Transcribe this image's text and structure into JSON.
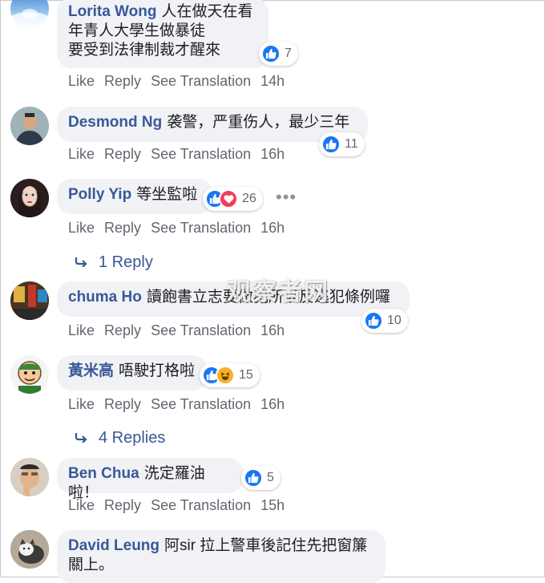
{
  "comments": [
    {
      "author": "Lorita Wong",
      "text": "人在做天在看\n年青人大學生做暴徒\n要受到法律制裁才醒來",
      "reactions": {
        "count": "7",
        "types": [
          "like"
        ]
      },
      "actions": {
        "like": "Like",
        "reply": "Reply",
        "translate": "See Translation",
        "time": "14h"
      }
    },
    {
      "author": "Desmond Ng",
      "text": "袭警，严重伤人，最少三年",
      "reactions": {
        "count": "11",
        "types": [
          "like"
        ]
      },
      "actions": {
        "like": "Like",
        "reply": "Reply",
        "translate": "See Translation",
        "time": "16h"
      }
    },
    {
      "author": "Polly Yip",
      "text": "等坐監啦",
      "reactions": {
        "count": "26",
        "types": [
          "like",
          "love"
        ]
      },
      "actions": {
        "like": "Like",
        "reply": "Reply",
        "translate": "See Translation",
        "time": "16h"
      },
      "replies": "1 Reply"
    },
    {
      "author": "chuma Ho",
      "text": "讀飽書立志要做犯所以反逃犯條例囉",
      "reactions": {
        "count": "10",
        "types": [
          "like"
        ]
      },
      "actions": {
        "like": "Like",
        "reply": "Reply",
        "translate": "See Translation",
        "time": "16h"
      }
    },
    {
      "author": "黃米高",
      "text": "唔駛打格啦",
      "reactions": {
        "count": "15",
        "types": [
          "like",
          "haha"
        ]
      },
      "actions": {
        "like": "Like",
        "reply": "Reply",
        "translate": "See Translation",
        "time": "16h"
      },
      "replies": "4 Replies"
    },
    {
      "author": "Ben Chua",
      "text": "洗定羅油啦！",
      "reactions": {
        "count": "5",
        "types": [
          "like"
        ]
      },
      "actions": {
        "like": "Like",
        "reply": "Reply",
        "translate": "See Translation",
        "time": "15h"
      }
    },
    {
      "author": "David Leung",
      "text": "阿sir 拉上警車後記住先把窗簾\n關上。"
    }
  ],
  "watermark": "观察者网",
  "colors": {
    "author": "#385898",
    "bubble": "#f0f2f5",
    "like": "#1877f2",
    "love": "#f33e58",
    "haha": "#f7b125",
    "meta": "#606770"
  }
}
